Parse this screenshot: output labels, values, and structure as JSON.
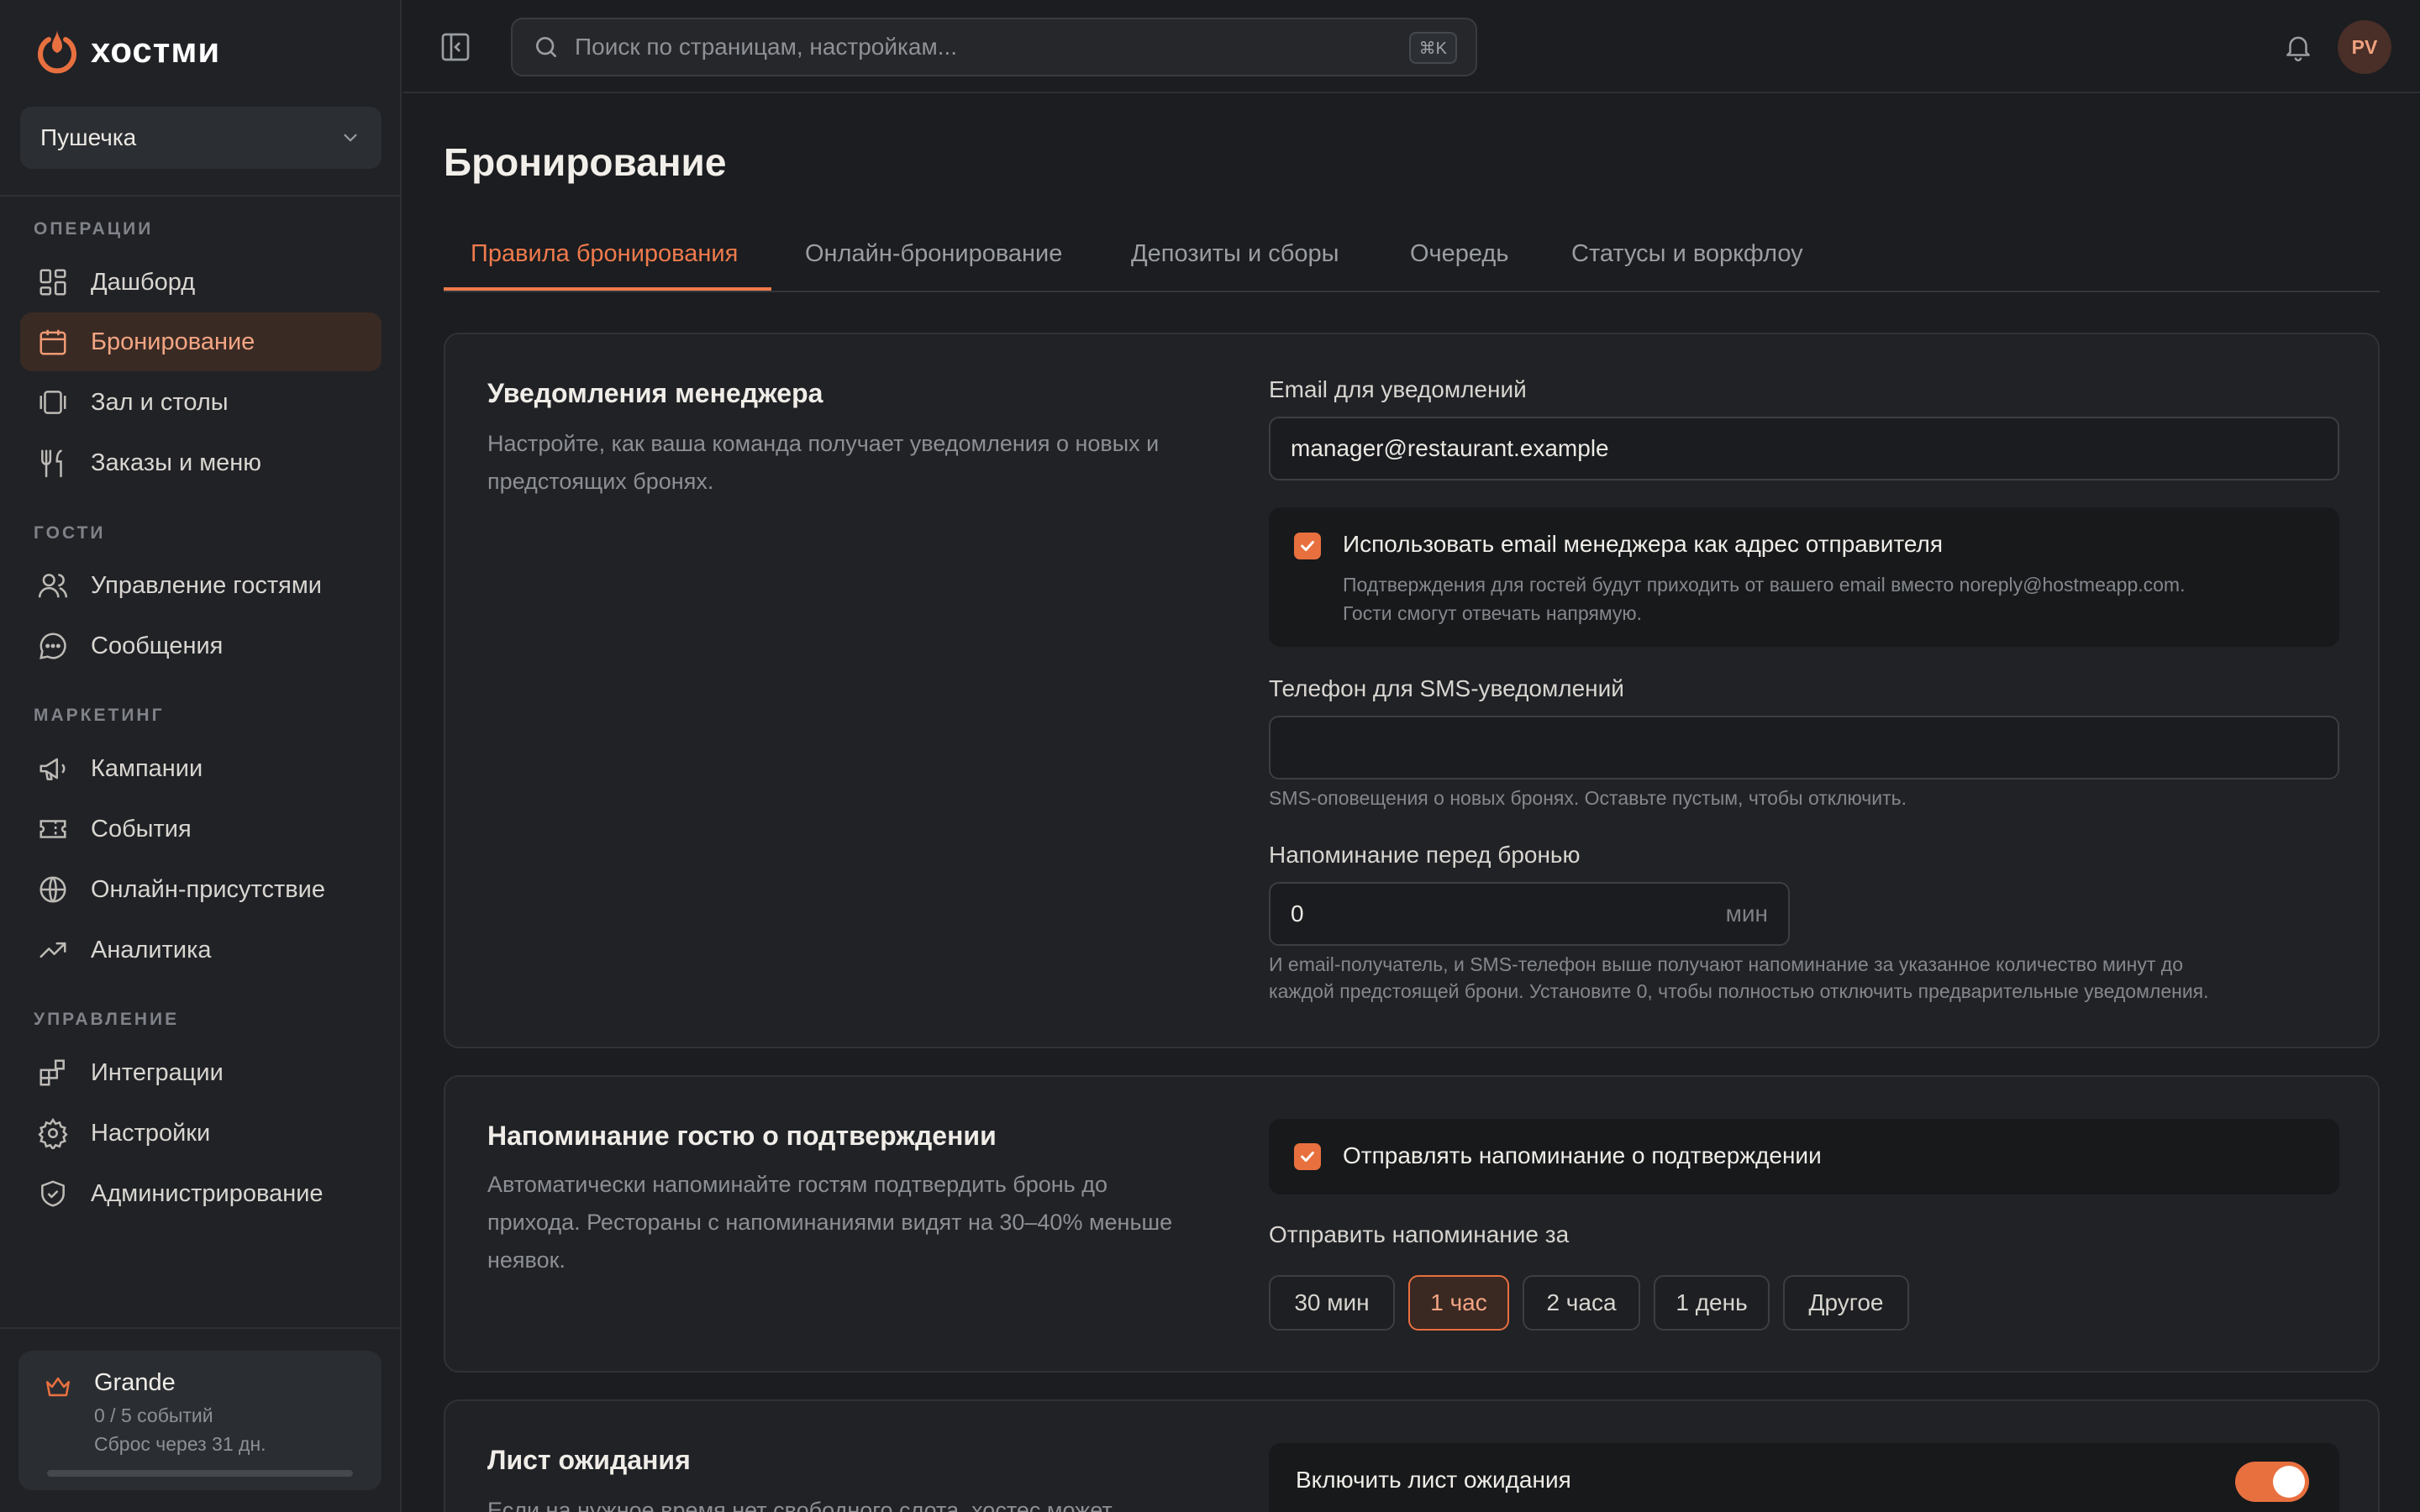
{
  "brand": {
    "name": "хостми",
    "accent": "#e8703f"
  },
  "venue": {
    "name": "Пушечка"
  },
  "sidebar": {
    "sections": [
      {
        "label": "ОПЕРАЦИИ",
        "items": [
          {
            "label": "Дашборд",
            "icon": "dashboard-icon"
          },
          {
            "label": "Бронирование",
            "icon": "calendar-icon",
            "active": true
          },
          {
            "label": "Зал и столы",
            "icon": "table-icon"
          },
          {
            "label": "Заказы и меню",
            "icon": "utensils-icon"
          }
        ]
      },
      {
        "label": "ГОСТИ",
        "items": [
          {
            "label": "Управление гостями",
            "icon": "users-icon"
          },
          {
            "label": "Сообщения",
            "icon": "chat-icon"
          }
        ]
      },
      {
        "label": "МАРКЕТИНГ",
        "items": [
          {
            "label": "Кампании",
            "icon": "megaphone-icon"
          },
          {
            "label": "События",
            "icon": "ticket-icon"
          },
          {
            "label": "Онлайн-присутствие",
            "icon": "globe-icon"
          },
          {
            "label": "Аналитика",
            "icon": "trending-icon"
          }
        ]
      },
      {
        "label": "УПРАВЛЕНИЕ",
        "items": [
          {
            "label": "Интеграции",
            "icon": "blocks-icon"
          },
          {
            "label": "Настройки",
            "icon": "gear-icon"
          },
          {
            "label": "Администрирование",
            "icon": "shield-icon"
          }
        ]
      }
    ],
    "plan": {
      "name": "Grande",
      "usage": "0 / 5 событий",
      "reset": "Сброс через 31 дн.",
      "progress": 0.0
    }
  },
  "topbar": {
    "search_placeholder": "Поиск по страницам, настройкам...",
    "shortcut": "⌘K",
    "avatar_initials": "PV"
  },
  "page": {
    "title": "Бронирование",
    "tabs": [
      {
        "label": "Правила бронирования",
        "active": true
      },
      {
        "label": "Онлайн-бронирование"
      },
      {
        "label": "Депозиты и сборы"
      },
      {
        "label": "Очередь"
      },
      {
        "label": "Статусы и воркфлоу"
      }
    ]
  },
  "manager_notifications": {
    "title": "Уведомления менеджера",
    "description": "Настройте, как ваша команда получает уведомления о новых и предстоящих бронях.",
    "email_label": "Email для уведомлений",
    "email_value": "manager@restaurant.example",
    "sender_checkbox_label": "Использовать email менеджера как адрес отправителя",
    "sender_checkbox_checked": true,
    "sender_hint_line1": "Подтверждения для гостей будут приходить от вашего email вместо noreply@hostmeapp.com.",
    "sender_hint_line2": "Гости смогут отвечать напрямую.",
    "phone_label": "Телефон для SMS-уведомлений",
    "phone_value": "",
    "phone_hint": "SMS-оповещения о новых бронях. Оставьте пустым, чтобы отключить.",
    "reminder_label": "Напоминание перед бронью",
    "reminder_value": "0",
    "reminder_unit": "мин",
    "reminder_hint_line1": "И email-получатель, и SMS-телефон выше получают напоминание за указанное количество минут до",
    "reminder_hint_line2": "каждой предстоящей брони. Установите 0, чтобы полностью отключить предварительные уведомления."
  },
  "guest_reminder": {
    "title": "Напоминание гостю о подтверждении",
    "description": "Автоматически напоминайте гостям подтвердить бронь до прихода. Рестораны с напоминаниями видят на 30–40% меньше неявок.",
    "checkbox_label": "Отправлять напоминание о подтверждении",
    "checkbox_checked": true,
    "send_before_label": "Отправить напоминание за",
    "options": [
      "30 мин",
      "1 час",
      "2 часа",
      "1 день",
      "Другое"
    ],
    "selected": "1 час"
  },
  "waitlist": {
    "title": "Лист ожидания",
    "description": "Если на нужное время нет свободного слота, хостес может",
    "toggle_label": "Включить лист ожидания",
    "toggle_on": true
  }
}
